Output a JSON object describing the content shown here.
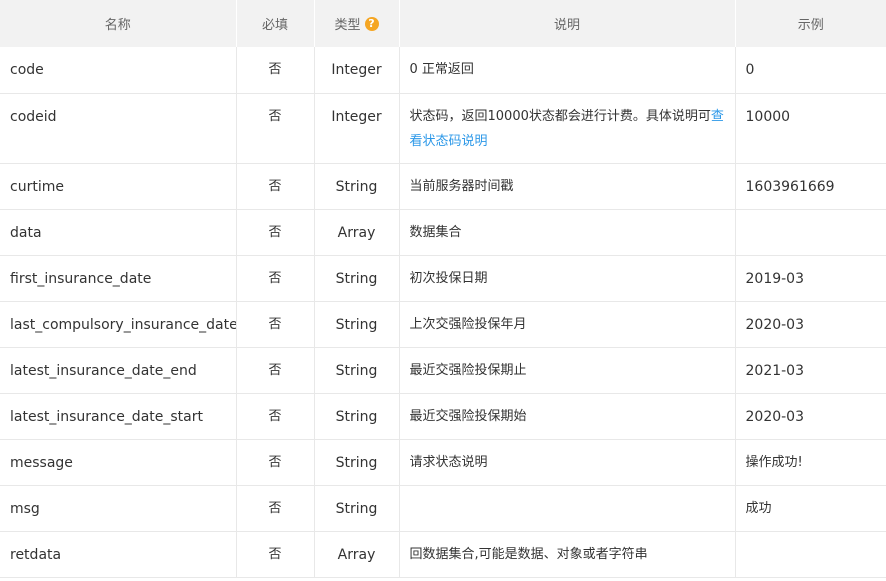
{
  "table": {
    "headers": {
      "name": "名称",
      "required": "必填",
      "type": "类型",
      "description": "说明",
      "example": "示例"
    },
    "help_icon": "question-mark-icon",
    "help_icon_glyph": "?",
    "help_icon_color": "#f5a623",
    "link_color": "#2c98e8",
    "rows": [
      {
        "name": "code",
        "required": "否",
        "type": "Integer",
        "description": "0 正常返回",
        "example": "0"
      },
      {
        "name": "codeid",
        "required": "否",
        "type": "Integer",
        "description": "状态码，返回10000状态都会进行计费。具体说明可",
        "description_link": "查看状态码说明",
        "example": "10000"
      },
      {
        "name": "curtime",
        "required": "否",
        "type": "String",
        "description": "当前服务器时间戳",
        "example": "1603961669"
      },
      {
        "name": "data",
        "required": "否",
        "type": "Array",
        "description": "数据集合",
        "example": ""
      },
      {
        "name": "first_insurance_date",
        "required": "否",
        "type": "String",
        "description": "初次投保日期",
        "example": "2019-03"
      },
      {
        "name": "last_compulsory_insurance_date",
        "required": "否",
        "type": "String",
        "description": "上次交强险投保年月",
        "example": "2020-03"
      },
      {
        "name": "latest_insurance_date_end",
        "required": "否",
        "type": "String",
        "description": "最近交强险投保期止",
        "example": "2021-03"
      },
      {
        "name": "latest_insurance_date_start",
        "required": "否",
        "type": "String",
        "description": "最近交强险投保期始",
        "example": "2020-03"
      },
      {
        "name": "message",
        "required": "否",
        "type": "String",
        "description": "请求状态说明",
        "example": "操作成功!"
      },
      {
        "name": "msg",
        "required": "否",
        "type": "String",
        "description": "",
        "example": "成功"
      },
      {
        "name": "retdata",
        "required": "否",
        "type": "Array",
        "description": "回数据集合,可能是数据、对象或者字符串",
        "example": ""
      }
    ]
  }
}
